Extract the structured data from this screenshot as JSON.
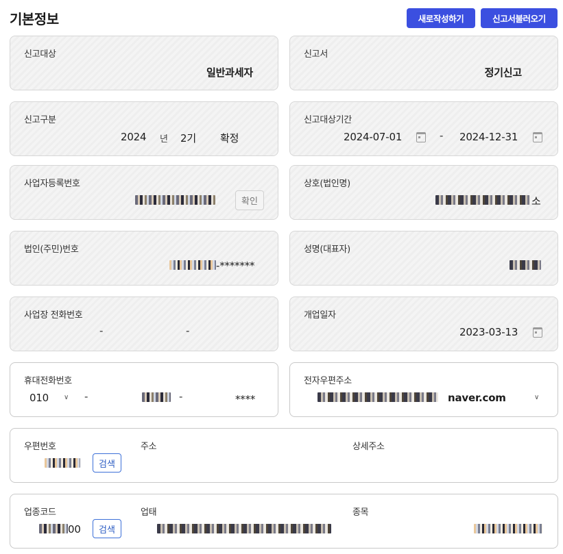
{
  "header": {
    "title": "기본정보",
    "new_button": "새로작성하기",
    "load_button": "신고서불러오기"
  },
  "report_target": {
    "label": "신고대상",
    "value": "일반과세자"
  },
  "report_form": {
    "label": "신고서",
    "value": "정기신고"
  },
  "report_type": {
    "label": "신고구분",
    "year": "2024",
    "year_unit": "년",
    "period": "2기",
    "status": "확정"
  },
  "report_period": {
    "label": "신고대상기간",
    "start": "2024-07-01",
    "separator": "-",
    "end": "2024-12-31"
  },
  "business_no": {
    "label": "사업자등록번호",
    "confirm_button": "확인"
  },
  "company_name": {
    "label": "상호(법인명)",
    "suffix": "소"
  },
  "corp_no": {
    "label": "법인(주민)번호",
    "masked_suffix": "-*******"
  },
  "representative": {
    "label": "성명(대표자)"
  },
  "business_phone": {
    "label": "사업장 전화번호",
    "sep1": "-",
    "sep2": "-"
  },
  "opening_date": {
    "label": "개업일자",
    "value": "2023-03-13"
  },
  "mobile": {
    "label": "휴대전화번호",
    "prefix": "010",
    "sep1": "-",
    "sep2": "-",
    "masked_last": "****"
  },
  "email": {
    "label": "전자우편주소",
    "domain": "naver.com"
  },
  "address": {
    "zip_label": "우편번호",
    "search_button": "검색",
    "address_label": "주소",
    "detail_label": "상세주소"
  },
  "industry": {
    "code_label": "업종코드",
    "code_suffix": "00",
    "search_button": "검색",
    "type_label": "업태",
    "item_label": "종목"
  }
}
